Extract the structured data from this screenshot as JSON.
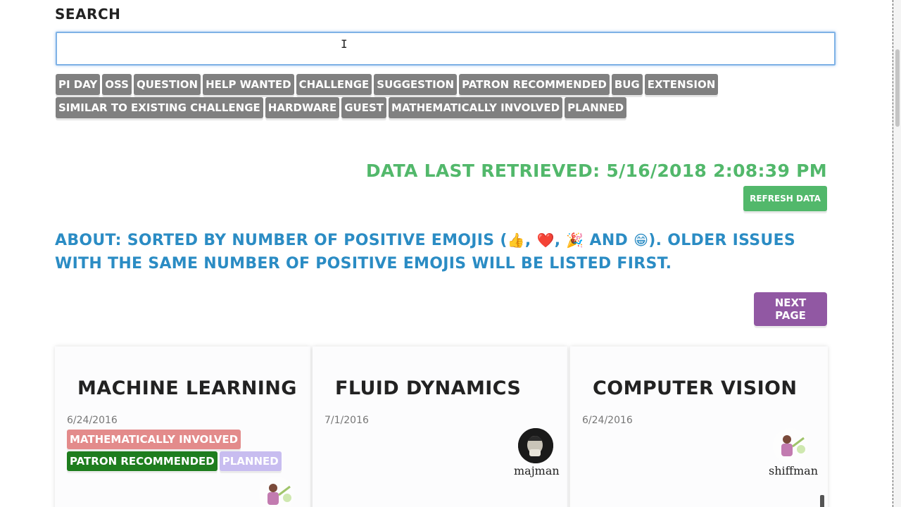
{
  "search": {
    "label": "Search",
    "value": "",
    "placeholder": ""
  },
  "tags": {
    "row1": [
      "Pi Day",
      "OSS",
      "Question",
      "Help Wanted",
      "Challenge",
      "Suggestion",
      "Patron Recommended",
      "Bug",
      "Extension"
    ],
    "row2": [
      "Similar to Existing Challenge",
      "Hardware",
      "Guest",
      "Mathematically Involved",
      "Planned"
    ]
  },
  "status": {
    "retrieved": "Data last retrieved: 5/16/2018 2:08:39 PM",
    "refresh_label": "Refresh data"
  },
  "about": {
    "text_before": "About: Sorted by number of positive emojis (",
    "emoji_1": "👍",
    "sep_1": ", ",
    "emoji_2": "❤️",
    "sep_2": ", ",
    "emoji_3": "🎉",
    "sep_3": " and ",
    "emoji_4": "😁",
    "text_after": "). Older issues with the same number of positive emojis will be listed first."
  },
  "pagination": {
    "next_label": "Next Page"
  },
  "cards": [
    {
      "title": "Machine Learning",
      "date": "6/24/2016",
      "tags_row1": [
        {
          "label": "Mathematically Involved",
          "color": "#e38b8b"
        }
      ],
      "tags_row2": [
        {
          "label": "Patron Recommended",
          "color": "#1e7d1e"
        },
        {
          "label": "Planned",
          "color": "#c8bdf0"
        }
      ],
      "author": ""
    },
    {
      "title": "Fluid Dynamics",
      "date": "7/1/2016",
      "author": "majman"
    },
    {
      "title": "Computer Vision",
      "date": "6/24/2016",
      "author": "shiffman"
    }
  ],
  "colors": {
    "accent_green": "#52b86b",
    "accent_blue": "#2b8cc4",
    "accent_purple": "#9158a3",
    "tag_gray": "#808080"
  }
}
